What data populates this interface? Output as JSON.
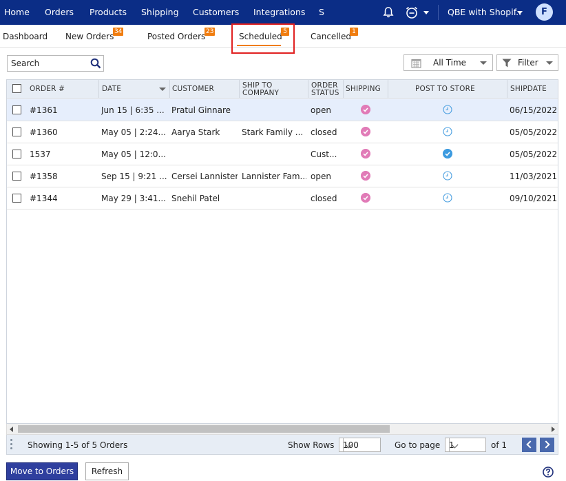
{
  "nav": {
    "items": [
      "Home",
      "Orders",
      "Products",
      "Shipping",
      "Customers",
      "Integrations",
      "S"
    ],
    "store_name": "QBE with Shopif..",
    "avatar_initial": "F"
  },
  "tabs": [
    {
      "label": "Dashboard",
      "count": ""
    },
    {
      "label": "New Orders",
      "count": "34"
    },
    {
      "label": "Posted Orders",
      "count": "23"
    },
    {
      "label": "Scheduled",
      "count": "5"
    },
    {
      "label": "Cancelled",
      "count": "1"
    }
  ],
  "active_tab": "Scheduled",
  "toolbar": {
    "search_placeholder": "Search",
    "date_range": "All Time",
    "filter_label": "Filter"
  },
  "table": {
    "columns": [
      "ORDER #",
      "DATE",
      "CUSTOMER",
      "SHIP TO COMPANY",
      "ORDER STATUS",
      "SHIPPING",
      "POST TO STORE",
      "SHIPDATE"
    ],
    "rows": [
      {
        "order": "#1361",
        "date": "Jun 15 | 6:35 ...",
        "customer": "Pratul Ginnare",
        "company": "",
        "status": "open",
        "shipping": "check",
        "post": "clock",
        "shipdate": "06/15/2022",
        "selected": true
      },
      {
        "order": "#1360",
        "date": "May 05 | 2:24...",
        "customer": "Aarya Stark",
        "company": "Stark Family ...",
        "status": "closed",
        "shipping": "check",
        "post": "clock",
        "shipdate": "05/05/2022",
        "selected": false
      },
      {
        "order": "1537",
        "date": "May 05 | 12:0...",
        "customer": "",
        "company": "",
        "status": "Cust...",
        "shipping": "check",
        "post": "done",
        "shipdate": "05/05/2022",
        "selected": false
      },
      {
        "order": "#1358",
        "date": "Sep 15 | 9:21 ...",
        "customer": "Cersei Lannister",
        "company": "Lannister Fam...",
        "status": "open",
        "shipping": "check",
        "post": "clock",
        "shipdate": "11/03/2021",
        "selected": false
      },
      {
        "order": "#1344",
        "date": "May 29 | 3:41...",
        "customer": "Snehil Patel",
        "company": "",
        "status": "closed",
        "shipping": "check",
        "post": "clock",
        "shipdate": "09/10/2021",
        "selected": false
      }
    ]
  },
  "footer": {
    "showing_text": "Showing 1-5 of 5 Orders",
    "show_rows_label": "Show Rows",
    "show_rows_value": "100",
    "goto_label": "Go to page",
    "page_value": "1",
    "of_text": "of 1"
  },
  "actions": {
    "move_label": "Move to Orders",
    "refresh_label": "Refresh"
  },
  "colors": {
    "nav_bg": "#0b2d86",
    "badge": "#f07d10",
    "highlight_box": "#e02020",
    "shipping_check": "#e17bb7",
    "post_done": "#3d9be0",
    "primary_button": "#2f3f9e"
  }
}
